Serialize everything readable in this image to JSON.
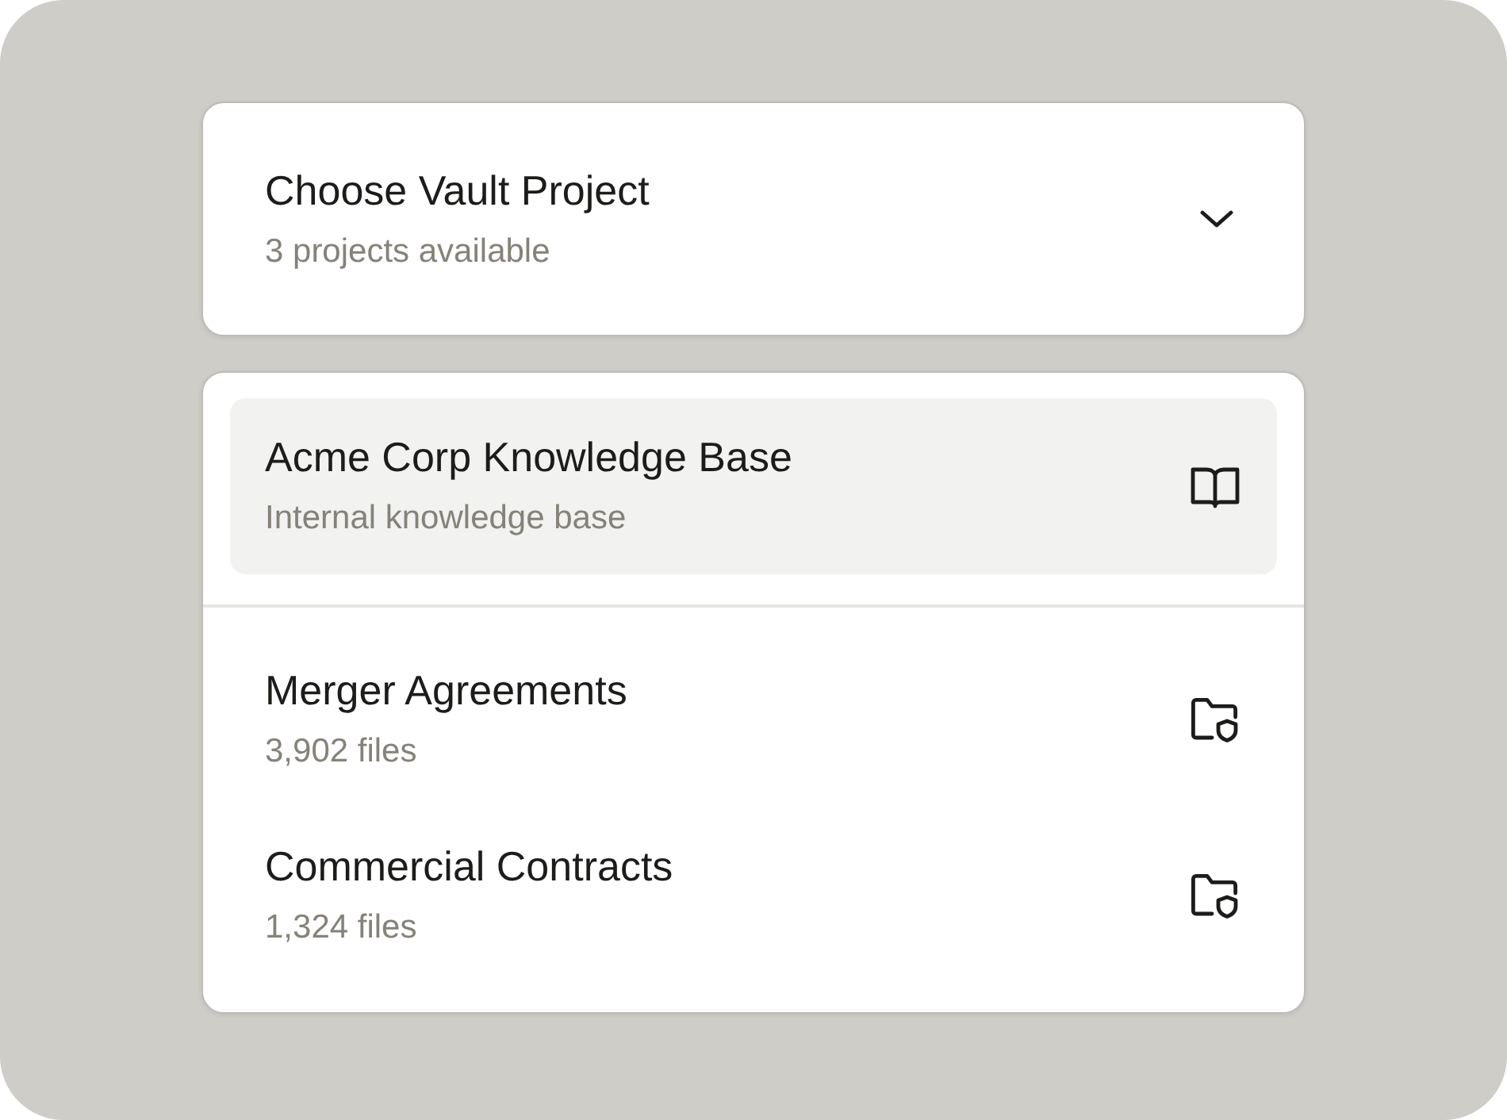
{
  "dropdown": {
    "title": "Choose Vault Project",
    "subtitle": "3 projects available"
  },
  "projects": [
    {
      "name": "Acme Corp Knowledge Base",
      "detail": "Internal knowledge base",
      "kind": "knowledge_base",
      "selected": true
    },
    {
      "name": "Merger Agreements",
      "detail": "3,902 files",
      "kind": "folder",
      "selected": false
    },
    {
      "name": "Commercial Contracts",
      "detail": "1,324 files",
      "kind": "folder",
      "selected": false
    }
  ]
}
